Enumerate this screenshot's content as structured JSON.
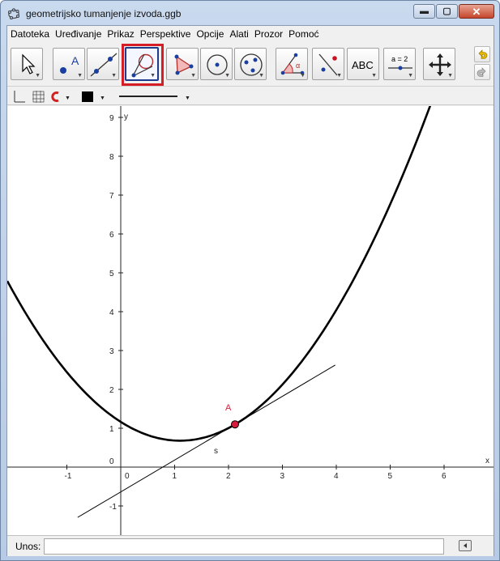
{
  "window": {
    "title": "geometrijsko tumanjenje izvoda.ggb",
    "minimize_glyph": "▬",
    "maximize_glyph": "▢",
    "close_glyph": "✕"
  },
  "menu": [
    "Datoteka",
    "Uređivanje",
    "Prikaz",
    "Perspektive",
    "Opcije",
    "Alati",
    "Prozor",
    "Pomoć"
  ],
  "toolbar": {
    "tools": [
      {
        "name": "move-tool-button",
        "icon": "arrow-pointer-icon"
      },
      {
        "name": "point-tool-button",
        "icon": "point-a-icon",
        "label": "A"
      },
      {
        "name": "line-tool-button",
        "icon": "line-through-points-icon"
      },
      {
        "name": "tangent-tool-button",
        "icon": "tangent-to-circle-icon",
        "selected": true
      },
      {
        "name": "polygon-tool-button",
        "icon": "polygon-icon"
      },
      {
        "name": "circle-tool-button",
        "icon": "circle-center-point-icon"
      },
      {
        "name": "ellipse-tool-button",
        "icon": "ellipse-icon"
      },
      {
        "name": "angle-tool-button",
        "icon": "angle-alpha-icon",
        "label": "α"
      },
      {
        "name": "reflect-tool-button",
        "icon": "reflect-about-line-icon"
      },
      {
        "name": "text-tool-button",
        "icon": "text-abc-icon",
        "label": "ABC"
      },
      {
        "name": "slider-tool-button",
        "icon": "slider-icon",
        "label": "a = 2"
      },
      {
        "name": "move-view-tool-button",
        "icon": "move-graphics-view-icon"
      }
    ],
    "highlight_color": "#d61c25"
  },
  "graphics": {
    "x_axis_label": "x",
    "y_axis_label": "y",
    "x_ticks": [
      "-1",
      "0",
      "1",
      "2",
      "3",
      "4",
      "5",
      "6"
    ],
    "y_ticks": [
      "-1",
      "0",
      "1",
      "2",
      "3",
      "4",
      "5",
      "6",
      "7",
      "8",
      "9"
    ],
    "point_label": "A",
    "line_label": "s",
    "point_color": "#d81b3c",
    "point": {
      "x": 2.12,
      "y": 1.1
    },
    "vertex": {
      "x": 1.1,
      "y": 0.68
    },
    "curve_coefficient": 0.4,
    "tangent_slope": 0.82
  },
  "input": {
    "label": "Unos:",
    "value": ""
  }
}
